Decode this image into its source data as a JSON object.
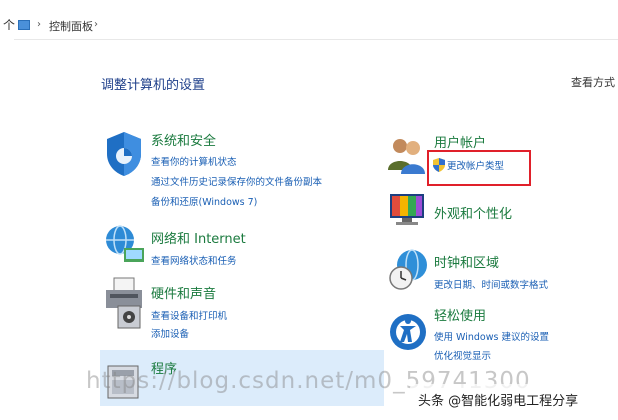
{
  "address_bar": {
    "breadcrumb": "控制面板"
  },
  "main": {
    "title": "调整计算机的设置",
    "view_by": "查看方式"
  },
  "categories": {
    "system_security": {
      "title": "系统和安全",
      "links": [
        "查看你的计算机状态",
        "通过文件历史记录保存你的文件备份副本",
        "备份和还原(Windows 7)"
      ]
    },
    "network": {
      "title": "网络和 Internet",
      "links": [
        "查看网络状态和任务"
      ]
    },
    "hardware": {
      "title": "硬件和声音",
      "links": [
        "查看设备和打印机",
        "添加设备"
      ]
    },
    "programs": {
      "title": "程序"
    },
    "user_accounts": {
      "title": "用户帐户",
      "links": [
        "更改帐户类型"
      ]
    },
    "appearance": {
      "title": "外观和个性化"
    },
    "clock_region": {
      "title": "时钟和区域",
      "links": [
        "更改日期、时间或数字格式"
      ]
    },
    "ease_of_access": {
      "title": "轻松使用",
      "links": [
        "使用 Windows 建议的设置",
        "优化视觉显示"
      ]
    }
  },
  "overlay": {
    "watermark": "https://blog.csdn.net/m0_59741300",
    "credit": "头条 @智能化弱电工程分享"
  },
  "colors": {
    "title_blue": "#1e3f8a",
    "category_green": "#1a7a3e",
    "link_blue": "#1a5fb4",
    "highlight_box": "#e0202a",
    "selection_bg": "#dcecfb"
  }
}
